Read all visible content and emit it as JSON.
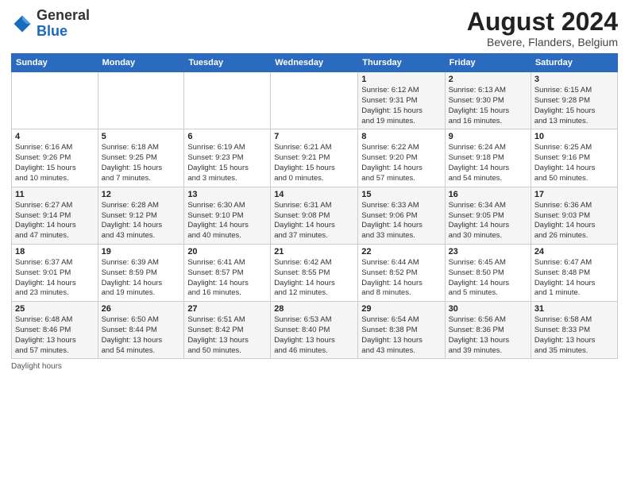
{
  "header": {
    "logo_general": "General",
    "logo_blue": "Blue",
    "month_year": "August 2024",
    "location": "Bevere, Flanders, Belgium"
  },
  "days_of_week": [
    "Sunday",
    "Monday",
    "Tuesday",
    "Wednesday",
    "Thursday",
    "Friday",
    "Saturday"
  ],
  "weeks": [
    [
      {
        "day": "",
        "info": ""
      },
      {
        "day": "",
        "info": ""
      },
      {
        "day": "",
        "info": ""
      },
      {
        "day": "",
        "info": ""
      },
      {
        "day": "1",
        "info": "Sunrise: 6:12 AM\nSunset: 9:31 PM\nDaylight: 15 hours\nand 19 minutes."
      },
      {
        "day": "2",
        "info": "Sunrise: 6:13 AM\nSunset: 9:30 PM\nDaylight: 15 hours\nand 16 minutes."
      },
      {
        "day": "3",
        "info": "Sunrise: 6:15 AM\nSunset: 9:28 PM\nDaylight: 15 hours\nand 13 minutes."
      }
    ],
    [
      {
        "day": "4",
        "info": "Sunrise: 6:16 AM\nSunset: 9:26 PM\nDaylight: 15 hours\nand 10 minutes."
      },
      {
        "day": "5",
        "info": "Sunrise: 6:18 AM\nSunset: 9:25 PM\nDaylight: 15 hours\nand 7 minutes."
      },
      {
        "day": "6",
        "info": "Sunrise: 6:19 AM\nSunset: 9:23 PM\nDaylight: 15 hours\nand 3 minutes."
      },
      {
        "day": "7",
        "info": "Sunrise: 6:21 AM\nSunset: 9:21 PM\nDaylight: 15 hours\nand 0 minutes."
      },
      {
        "day": "8",
        "info": "Sunrise: 6:22 AM\nSunset: 9:20 PM\nDaylight: 14 hours\nand 57 minutes."
      },
      {
        "day": "9",
        "info": "Sunrise: 6:24 AM\nSunset: 9:18 PM\nDaylight: 14 hours\nand 54 minutes."
      },
      {
        "day": "10",
        "info": "Sunrise: 6:25 AM\nSunset: 9:16 PM\nDaylight: 14 hours\nand 50 minutes."
      }
    ],
    [
      {
        "day": "11",
        "info": "Sunrise: 6:27 AM\nSunset: 9:14 PM\nDaylight: 14 hours\nand 47 minutes."
      },
      {
        "day": "12",
        "info": "Sunrise: 6:28 AM\nSunset: 9:12 PM\nDaylight: 14 hours\nand 43 minutes."
      },
      {
        "day": "13",
        "info": "Sunrise: 6:30 AM\nSunset: 9:10 PM\nDaylight: 14 hours\nand 40 minutes."
      },
      {
        "day": "14",
        "info": "Sunrise: 6:31 AM\nSunset: 9:08 PM\nDaylight: 14 hours\nand 37 minutes."
      },
      {
        "day": "15",
        "info": "Sunrise: 6:33 AM\nSunset: 9:06 PM\nDaylight: 14 hours\nand 33 minutes."
      },
      {
        "day": "16",
        "info": "Sunrise: 6:34 AM\nSunset: 9:05 PM\nDaylight: 14 hours\nand 30 minutes."
      },
      {
        "day": "17",
        "info": "Sunrise: 6:36 AM\nSunset: 9:03 PM\nDaylight: 14 hours\nand 26 minutes."
      }
    ],
    [
      {
        "day": "18",
        "info": "Sunrise: 6:37 AM\nSunset: 9:01 PM\nDaylight: 14 hours\nand 23 minutes."
      },
      {
        "day": "19",
        "info": "Sunrise: 6:39 AM\nSunset: 8:59 PM\nDaylight: 14 hours\nand 19 minutes."
      },
      {
        "day": "20",
        "info": "Sunrise: 6:41 AM\nSunset: 8:57 PM\nDaylight: 14 hours\nand 16 minutes."
      },
      {
        "day": "21",
        "info": "Sunrise: 6:42 AM\nSunset: 8:55 PM\nDaylight: 14 hours\nand 12 minutes."
      },
      {
        "day": "22",
        "info": "Sunrise: 6:44 AM\nSunset: 8:52 PM\nDaylight: 14 hours\nand 8 minutes."
      },
      {
        "day": "23",
        "info": "Sunrise: 6:45 AM\nSunset: 8:50 PM\nDaylight: 14 hours\nand 5 minutes."
      },
      {
        "day": "24",
        "info": "Sunrise: 6:47 AM\nSunset: 8:48 PM\nDaylight: 14 hours\nand 1 minute."
      }
    ],
    [
      {
        "day": "25",
        "info": "Sunrise: 6:48 AM\nSunset: 8:46 PM\nDaylight: 13 hours\nand 57 minutes."
      },
      {
        "day": "26",
        "info": "Sunrise: 6:50 AM\nSunset: 8:44 PM\nDaylight: 13 hours\nand 54 minutes."
      },
      {
        "day": "27",
        "info": "Sunrise: 6:51 AM\nSunset: 8:42 PM\nDaylight: 13 hours\nand 50 minutes."
      },
      {
        "day": "28",
        "info": "Sunrise: 6:53 AM\nSunset: 8:40 PM\nDaylight: 13 hours\nand 46 minutes."
      },
      {
        "day": "29",
        "info": "Sunrise: 6:54 AM\nSunset: 8:38 PM\nDaylight: 13 hours\nand 43 minutes."
      },
      {
        "day": "30",
        "info": "Sunrise: 6:56 AM\nSunset: 8:36 PM\nDaylight: 13 hours\nand 39 minutes."
      },
      {
        "day": "31",
        "info": "Sunrise: 6:58 AM\nSunset: 8:33 PM\nDaylight: 13 hours\nand 35 minutes."
      }
    ]
  ],
  "footer": "Daylight hours"
}
